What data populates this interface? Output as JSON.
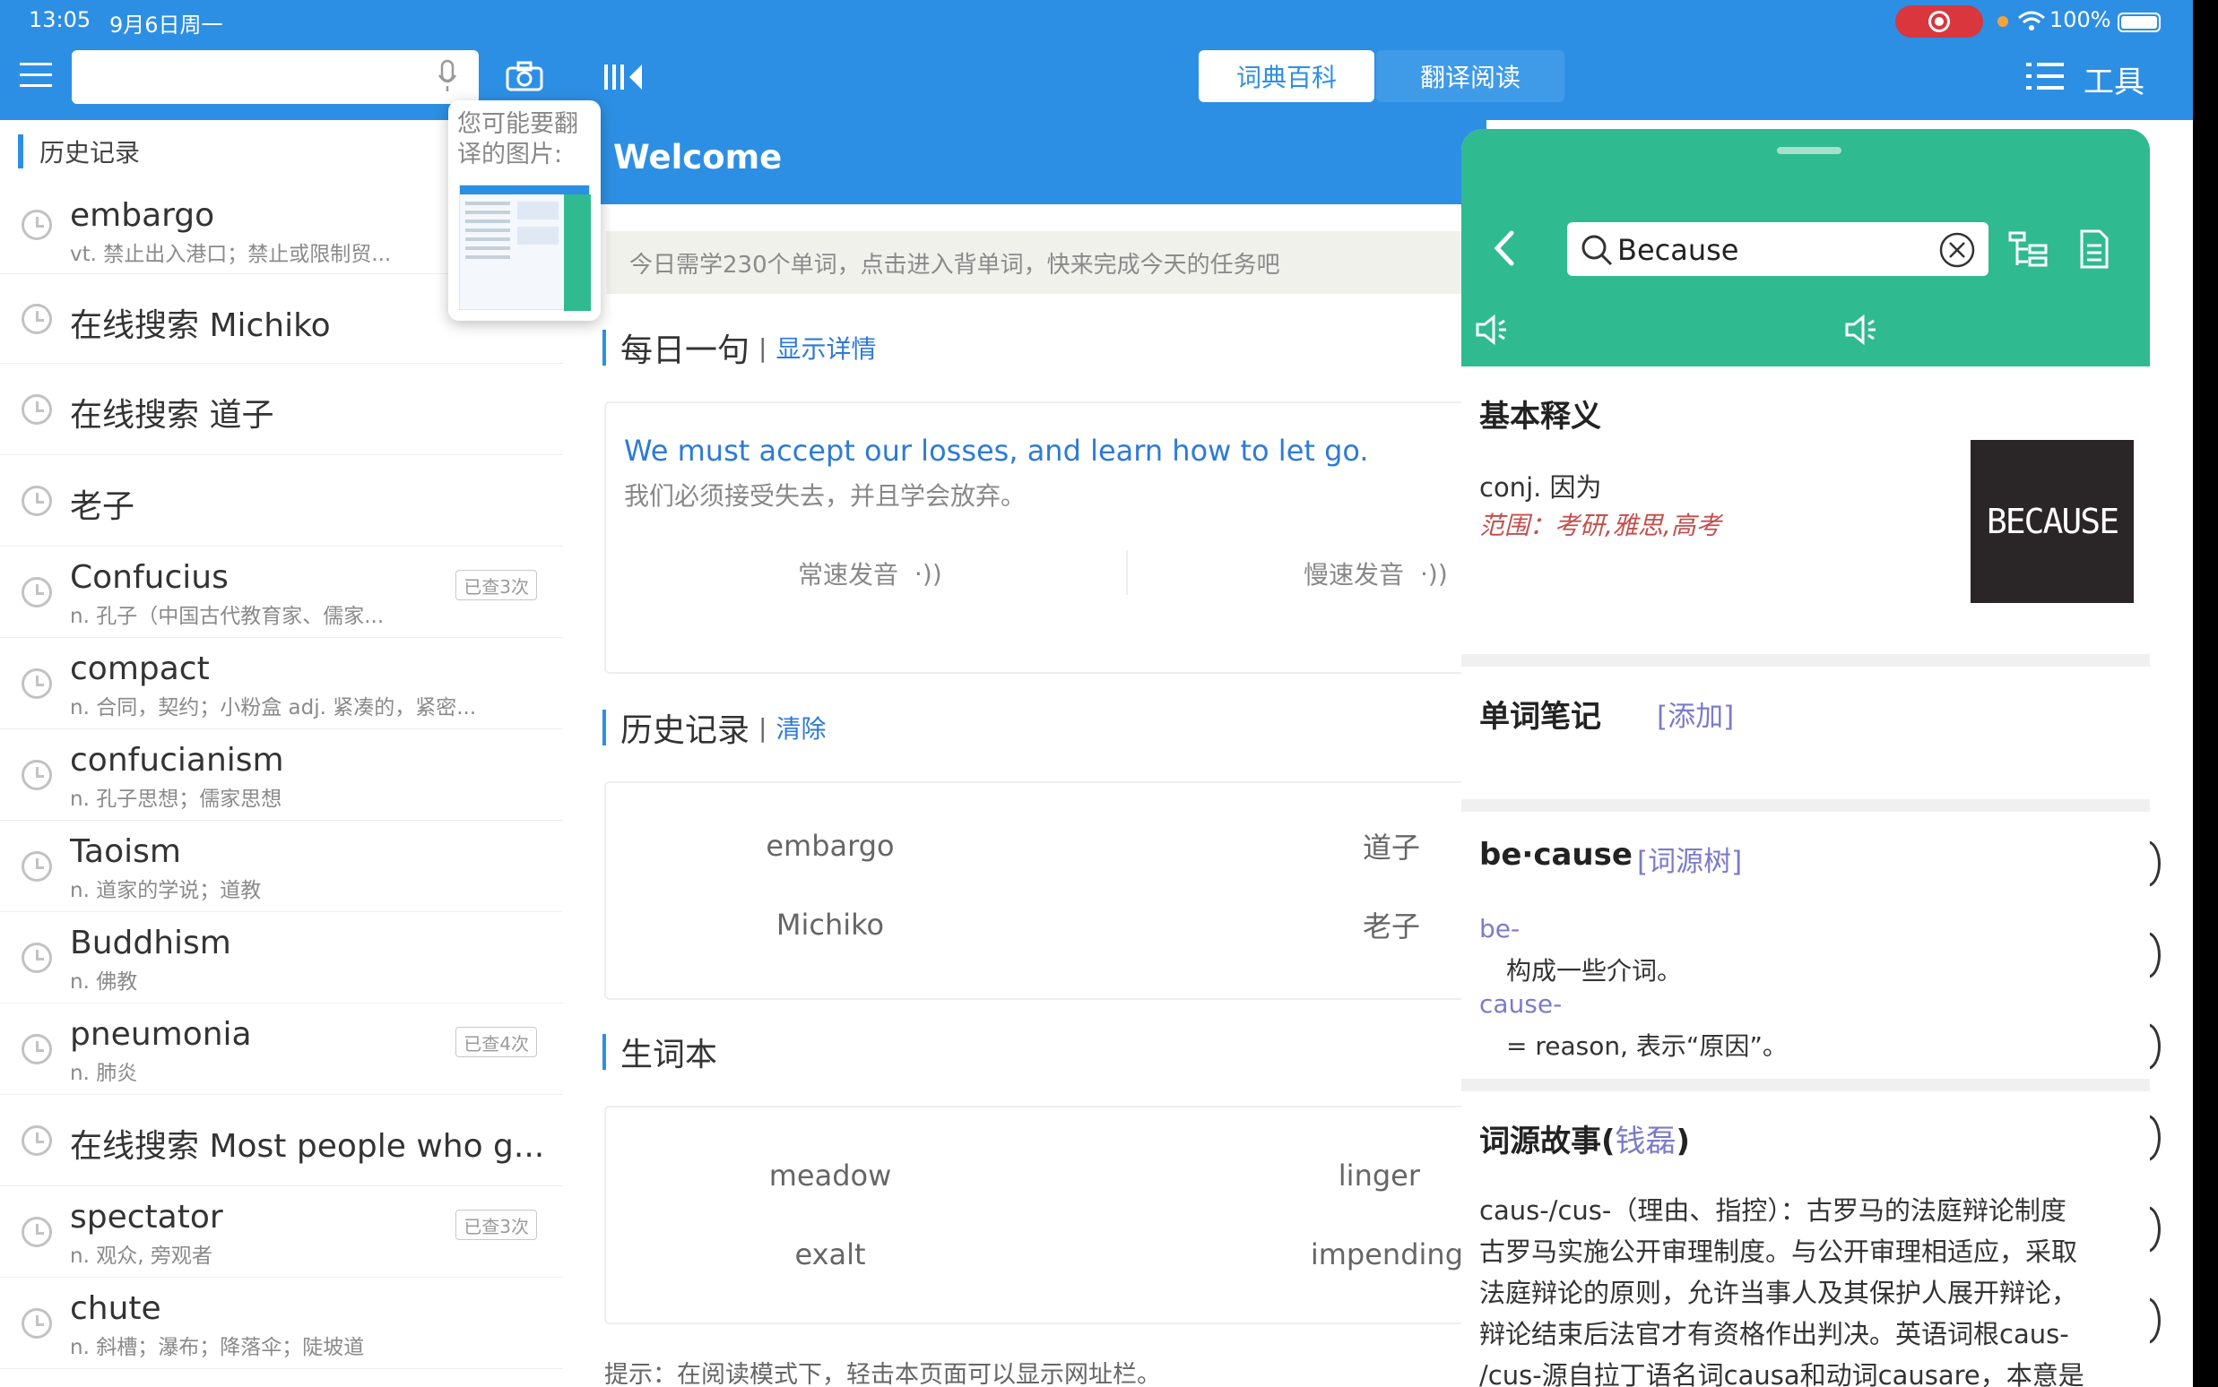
{
  "status_bar": {
    "time": "13:05",
    "date": "9月6日周一",
    "battery": "100%"
  },
  "toolbar": {
    "search_placeholder": "",
    "tabs": [
      {
        "label": "词典百科",
        "active": true
      },
      {
        "label": "翻译阅读",
        "active": false
      }
    ],
    "tools_label": "工具"
  },
  "photo_hint": {
    "text": "您可能要翻译的图片:"
  },
  "sidebar": {
    "title": "历史记录",
    "items": [
      {
        "word": "embargo",
        "def": "vt. 禁止出入港口；禁止或限制贸...",
        "badge": ""
      },
      {
        "word": "在线搜索 Michiko",
        "def": "",
        "badge": ""
      },
      {
        "word": "在线搜索 道子",
        "def": "",
        "badge": ""
      },
      {
        "word": "老子",
        "def": "",
        "badge": ""
      },
      {
        "word": "Confucius",
        "def": "n. 孔子（中国古代教育家、儒家...",
        "badge": "已查3次"
      },
      {
        "word": "compact",
        "def": "n. 合同，契约；小粉盒 adj. 紧凑的，紧密...",
        "badge": ""
      },
      {
        "word": "confucianism",
        "def": "n. 孔子思想；儒家思想",
        "badge": ""
      },
      {
        "word": "Taoism",
        "def": "n. 道家的学说；道教",
        "badge": ""
      },
      {
        "word": "Buddhism",
        "def": "n. 佛教",
        "badge": ""
      },
      {
        "word": "pneumonia",
        "def": "n. 肺炎",
        "badge": "已查4次"
      },
      {
        "word": "在线搜索 Most people who g...",
        "def": "",
        "badge": ""
      },
      {
        "word": "spectator",
        "def": "n. 观众, 旁观者",
        "badge": "已查3次"
      },
      {
        "word": "chute",
        "def": "n. 斜槽；瀑布；降落伞；陡坡道",
        "badge": ""
      }
    ]
  },
  "main": {
    "welcome": "Welcome",
    "task_banner": "今日需学230个单词，点击进入背单词，快来完成今天的任务吧",
    "daily": {
      "title": "每日一句",
      "link": "显示详情",
      "sentence_en": "We must accept our losses, and learn how to let go.",
      "sentence_zh": "我们必须接受失去，并且学会放弃。",
      "normal_speed": "常速发音",
      "slow_speed": "慢速发音"
    },
    "history": {
      "title": "历史记录",
      "link": "清除",
      "words": [
        "embargo",
        "道子",
        "Michiko",
        "老子"
      ]
    },
    "vocab": {
      "title": "生词本",
      "words": [
        "meadow",
        "linger",
        "exalt",
        "impending"
      ]
    },
    "tip": "提示：在阅读模式下，轻击本页面可以显示网址栏。"
  },
  "panel": {
    "search_value": "Because",
    "basic_title": "基本释义",
    "pos_def": "conj. 因为",
    "scope": "范围：考研,雅思,高考",
    "image_text": "BECAUSE",
    "notes_title": "单词笔记",
    "notes_add": "[添加]",
    "syllables": "be·cause",
    "etym_tree": "[词源树]",
    "prefix1": "be-",
    "prefix1_def": "构成一些介词。",
    "prefix2": "cause-",
    "prefix2_def": "= reason, 表示“原因”。",
    "story_title": "词源故事(",
    "story_author": "钱磊",
    "story_close": ")",
    "story_lines": [
      "caus-/cus-（理由、指控）：古罗马的法庭辩论制度",
      "古罗马实施公开审理制度。与公开审理相适应，采取",
      "法庭辩论的原则，允许当事人及其保护人展开辩论，",
      "辩论结束后法官才有资格作出判决。英语词根caus-",
      "/cus-源自拉丁语名词causa和动词causare，本意是"
    ]
  },
  "colors": {
    "accent": "#2d8fe3",
    "panel_green": "#2fba8f",
    "link_blue": "#2d7ad8",
    "scope_red": "#c0504d",
    "etym_purple": "#7b7bc8"
  }
}
